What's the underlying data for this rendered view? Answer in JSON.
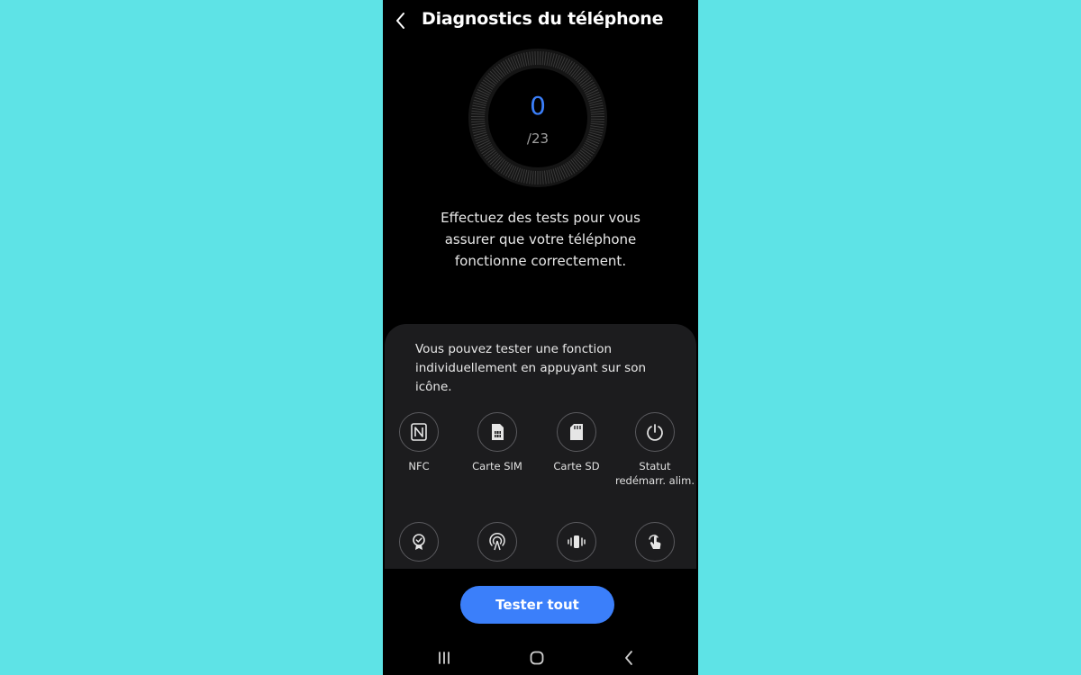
{
  "header": {
    "back_icon": "chevron-left-icon",
    "title": "Diagnostics du téléphone"
  },
  "progress": {
    "completed": "0",
    "total": "/23",
    "fraction": 0
  },
  "intro_text": "Effectuez des tests pour vous assurer que votre téléphone fonctionne correctement.",
  "card": {
    "info": "Vous pouvez tester une fonction individuellement en appuyant sur son icône.",
    "tests": [
      {
        "label": "NFC",
        "icon": "nfc-icon"
      },
      {
        "label": "Carte SIM",
        "icon": "sim-card-icon"
      },
      {
        "label": "Carte SD",
        "icon": "sd-card-icon"
      },
      {
        "label": "Statut redémarr. alim.",
        "icon": "power-restart-icon"
      },
      {
        "label": "",
        "icon": "badge-check-icon"
      },
      {
        "label": "",
        "icon": "antenna-signal-icon"
      },
      {
        "label": "",
        "icon": "vibration-icon"
      },
      {
        "label": "",
        "icon": "touch-icon"
      }
    ]
  },
  "actions": {
    "test_all": "Tester tout"
  },
  "navbar": {
    "recents_icon": "recents-icon",
    "home_icon": "home-icon",
    "back_icon": "nav-back-icon"
  },
  "colors": {
    "background": "#5ee3e6",
    "accent": "#3b7ffa",
    "screen": "#000000",
    "card": "#1c1c1e"
  }
}
